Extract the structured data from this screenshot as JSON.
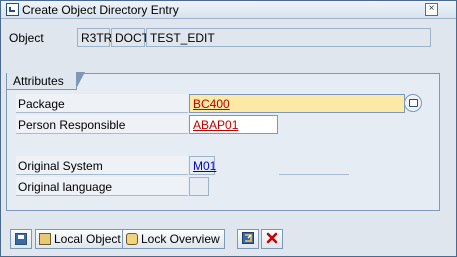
{
  "window": {
    "title": "Create Object Directory Entry",
    "close_glyph": "×"
  },
  "object": {
    "label": "Object",
    "pgmid": "R3TR",
    "type": "DOCT",
    "name": "TEST_EDIT"
  },
  "attributes": {
    "group_title": "Attributes",
    "package_label": "Package",
    "package_value": "BC400",
    "person_label": "Person Responsible",
    "person_value": "ABAP01",
    "orig_system_label": "Original System",
    "orig_system_value": "M01",
    "orig_lang_label": "Original language",
    "orig_lang_value": ""
  },
  "toolbar": {
    "local_object_label": "Local Object",
    "lock_overview_label": "Lock Overview"
  },
  "colors": {
    "required_bg": "#fbe9a5",
    "link_red": "#c00000",
    "cancel_red": "#cc0000"
  }
}
